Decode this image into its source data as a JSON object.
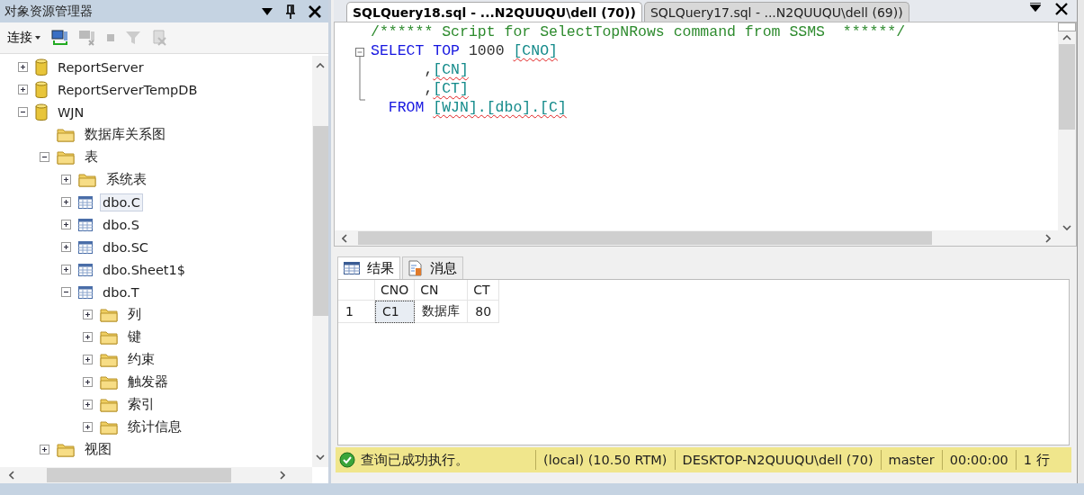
{
  "object_explorer": {
    "title": "对象资源管理器",
    "toolbar": {
      "connect_label": "连接"
    },
    "tree": [
      {
        "label": "ReportServer",
        "kind": "database",
        "expanded": false,
        "selected": false
      },
      {
        "label": "ReportServerTempDB",
        "kind": "database",
        "expanded": false,
        "selected": false
      },
      {
        "label": "WJN",
        "kind": "database",
        "expanded": true,
        "selected": false,
        "children": [
          {
            "label": "数据库关系图",
            "kind": "folder",
            "selected": false
          },
          {
            "label": "表",
            "kind": "folder",
            "expanded": true,
            "selected": false,
            "children": [
              {
                "label": "系统表",
                "kind": "folder",
                "expanded": false,
                "selected": false
              },
              {
                "label": "dbo.C",
                "kind": "table",
                "expanded": false,
                "selected": true
              },
              {
                "label": "dbo.S",
                "kind": "table",
                "expanded": false,
                "selected": false
              },
              {
                "label": "dbo.SC",
                "kind": "table",
                "expanded": false,
                "selected": false
              },
              {
                "label": "dbo.Sheet1$",
                "kind": "table",
                "expanded": false,
                "selected": false
              },
              {
                "label": "dbo.T",
                "kind": "table",
                "expanded": true,
                "selected": false,
                "children": [
                  {
                    "label": "列",
                    "kind": "folder",
                    "expanded": false,
                    "selected": false
                  },
                  {
                    "label": "键",
                    "kind": "folder",
                    "expanded": false,
                    "selected": false
                  },
                  {
                    "label": "约束",
                    "kind": "folder",
                    "expanded": false,
                    "selected": false
                  },
                  {
                    "label": "触发器",
                    "kind": "folder",
                    "expanded": false,
                    "selected": false
                  },
                  {
                    "label": "索引",
                    "kind": "folder",
                    "expanded": false,
                    "selected": false
                  },
                  {
                    "label": "统计信息",
                    "kind": "folder",
                    "expanded": false,
                    "selected": false
                  }
                ]
              }
            ]
          },
          {
            "label": "视图",
            "kind": "folder",
            "expanded": false,
            "selected": false
          }
        ]
      }
    ]
  },
  "editor": {
    "tabs": [
      {
        "label": "SQLQuery18.sql - ...N2QUUQU\\dell (70))",
        "selected": true
      },
      {
        "label": "SQLQuery17.sql - ...N2QUUQU\\dell (69))",
        "selected": false
      }
    ],
    "lines": [
      {
        "indented": false,
        "tokens": [
          {
            "kind": "comment",
            "text": "/****** Script for SelectTopNRows command from SSMS  ******/"
          }
        ]
      },
      {
        "indented": false,
        "tokens": [
          {
            "kind": "keyword",
            "text": "SELECT"
          },
          {
            "kind": "keyword",
            "text": "TOP",
            "space_before": true
          },
          {
            "kind": "plain",
            "text": "1000",
            "space_before": true
          },
          {
            "kind": "identifier",
            "text": "[CNO]",
            "space_before": true
          }
        ]
      },
      {
        "indented": false,
        "tokens": [
          {
            "kind": "plain",
            "text": "      ,"
          },
          {
            "kind": "identifier",
            "text": "[CN]"
          }
        ]
      },
      {
        "indented": false,
        "tokens": [
          {
            "kind": "plain",
            "text": "      ,"
          },
          {
            "kind": "identifier",
            "text": "[CT]"
          }
        ]
      },
      {
        "indented": true,
        "tokens": [
          {
            "kind": "keyword",
            "text": "FROM"
          },
          {
            "kind": "identifier",
            "text": "[WJN].[dbo].[C]",
            "space_before": true
          }
        ]
      }
    ]
  },
  "results": {
    "tabs": [
      {
        "label": "结果",
        "kind": "grid",
        "selected": true
      },
      {
        "label": "消息",
        "kind": "messages",
        "selected": false
      }
    ],
    "columns": [
      "CNO",
      "CN",
      "CT"
    ],
    "rows": [
      {
        "number": "1",
        "cells": [
          {
            "text": "C1",
            "selected": true
          },
          {
            "text": "数据库",
            "selected": false
          },
          {
            "text": "80",
            "selected": false
          }
        ]
      }
    ]
  },
  "status_bar": {
    "message": "查询已成功执行。",
    "server": "(local) (10.50 RTM)",
    "user": "DESKTOP-N2QUUQU\\dell (70)",
    "database": "master",
    "elapsed": "00:00:00",
    "rows": "1 行"
  }
}
